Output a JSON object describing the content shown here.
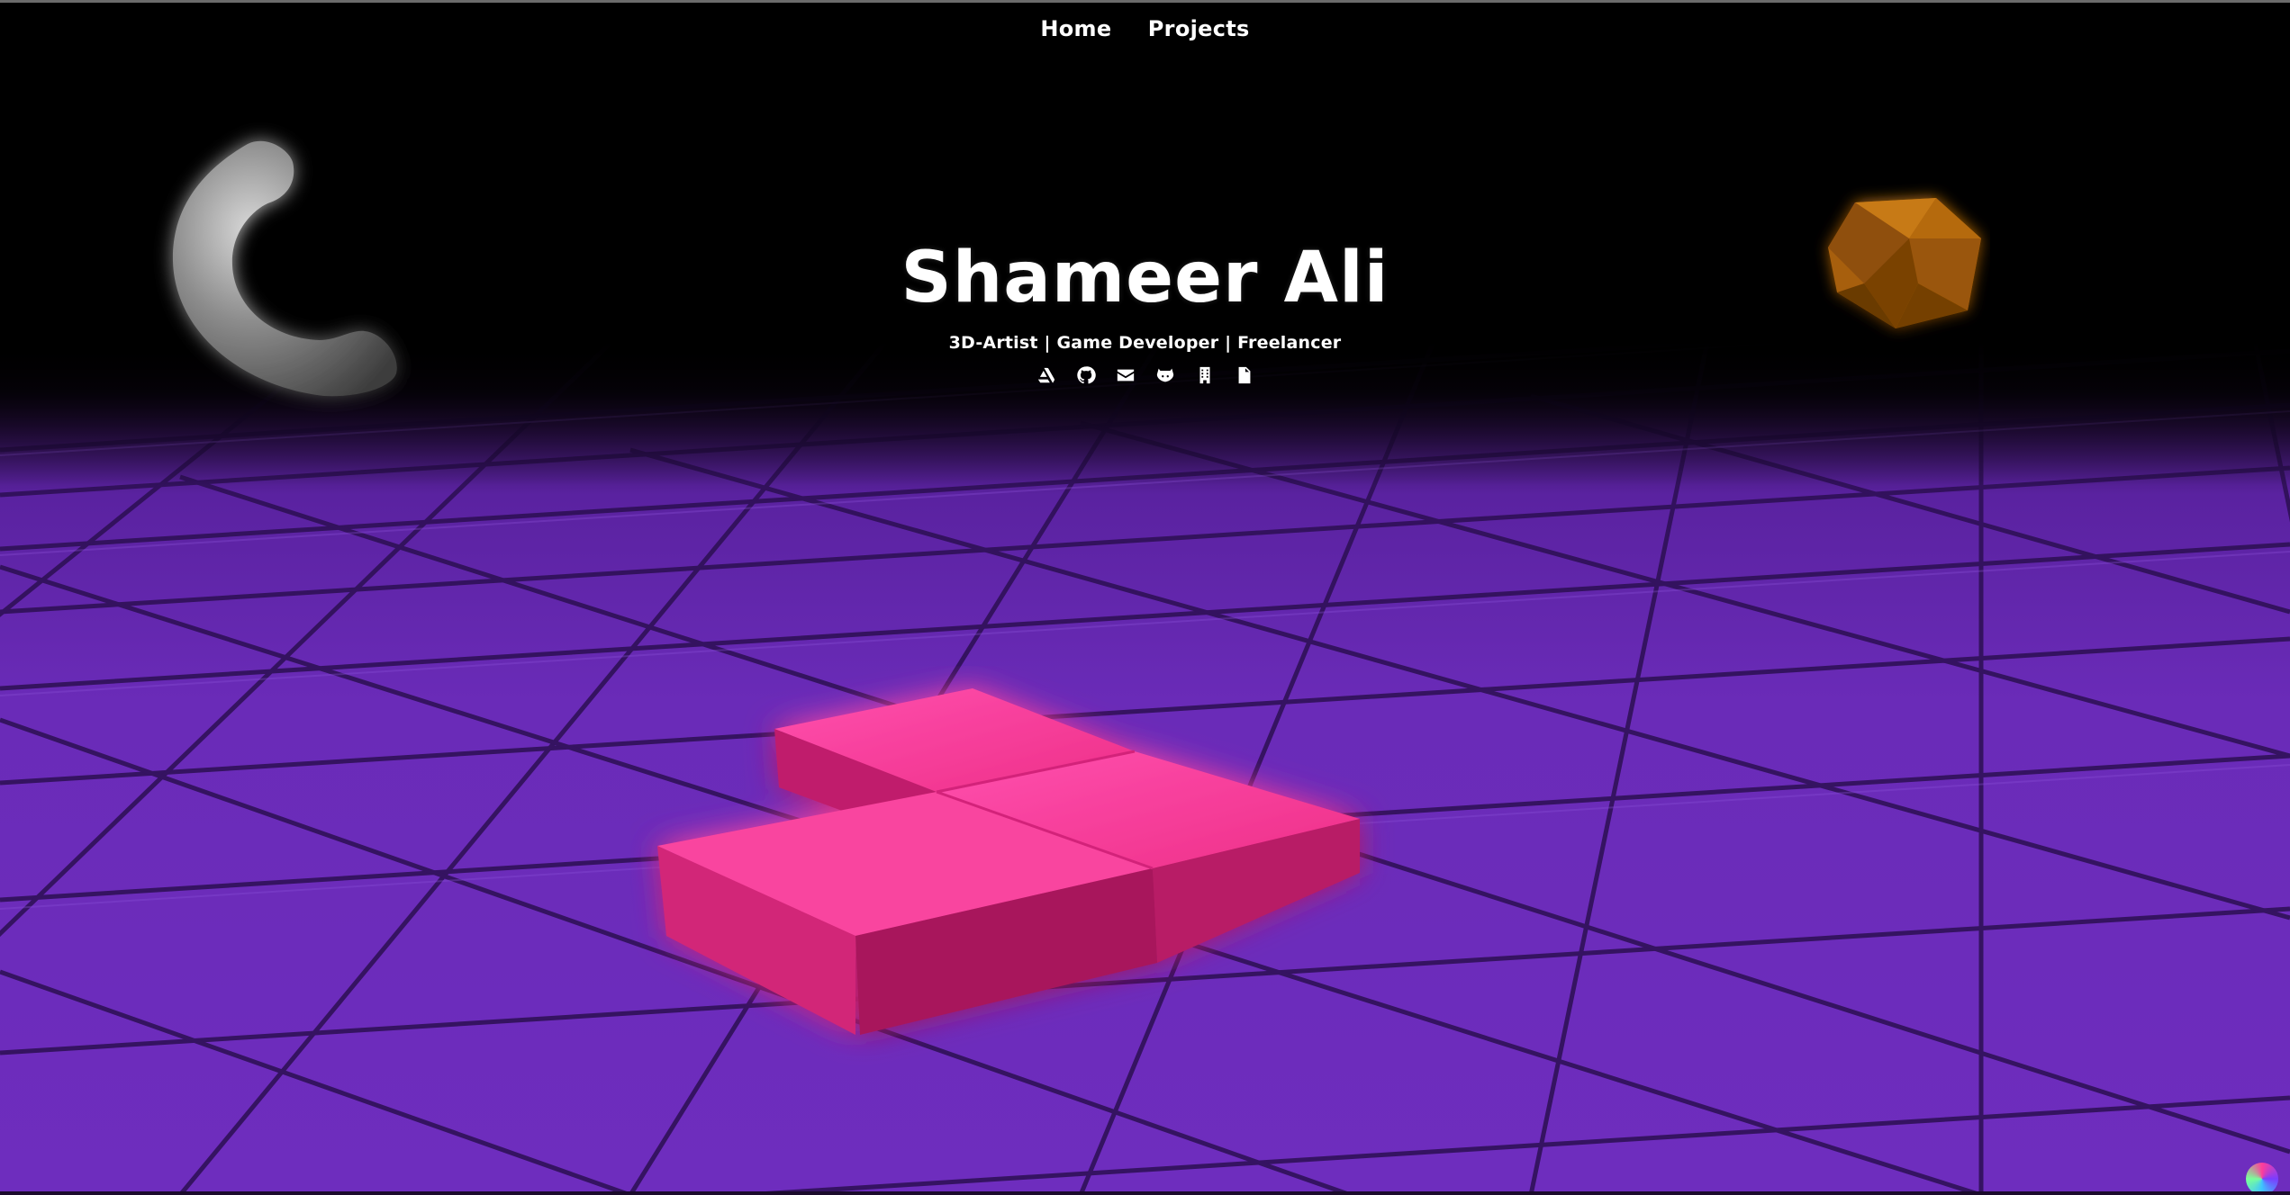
{
  "nav": {
    "home": "Home",
    "projects": "Projects"
  },
  "hero": {
    "name": "Shameer Ali",
    "subtitle": "3D-Artist | Game Developer | Freelancer"
  },
  "social_icons": [
    "artstation-icon",
    "github-icon",
    "email-icon",
    "gitlab-icon",
    "itch-building-icon",
    "pdf-resume-icon"
  ],
  "colors": {
    "floor": "#6a2bb8",
    "blocks": "#f0368f",
    "gem": "#b86a0f",
    "torus": "#8a8a8a",
    "text": "#ffffff"
  }
}
